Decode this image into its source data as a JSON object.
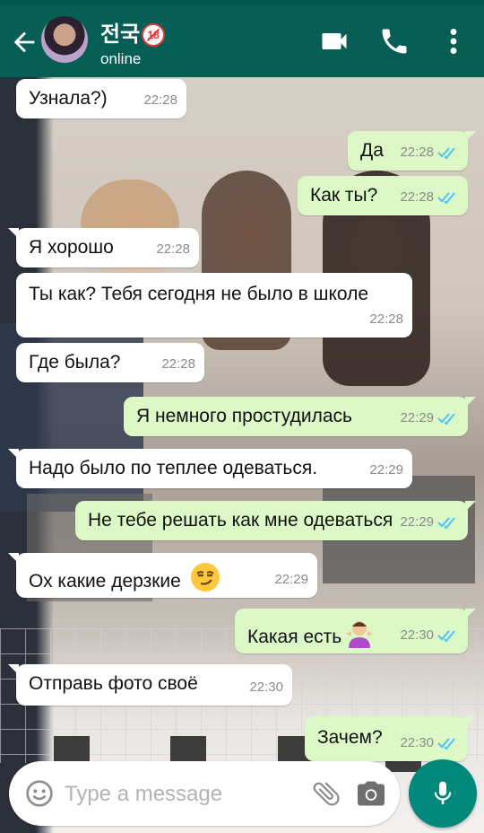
{
  "header": {
    "contact_name": "전국",
    "age_badge": "18",
    "status": "online"
  },
  "messages": [
    {
      "dir": "in",
      "text": "Узнала?)",
      "time": "22:28"
    },
    {
      "dir": "out",
      "text": "Да",
      "time": "22:28",
      "read": true
    },
    {
      "dir": "out",
      "text": "Как ты?",
      "time": "22:28",
      "read": true
    },
    {
      "dir": "in",
      "text": "Я хорошо",
      "time": "22:28"
    },
    {
      "dir": "in",
      "text": "Ты как? Тебя сегодня не было в школе",
      "time": "22:28"
    },
    {
      "dir": "in",
      "text": "Где была?",
      "time": "22:28"
    },
    {
      "dir": "out",
      "text": "Я немного простудилась",
      "time": "22:29",
      "read": true
    },
    {
      "dir": "in",
      "text": "Надо было по теплее одеваться.",
      "time": "22:29"
    },
    {
      "dir": "out",
      "text": "Не тебе решать как мне одеваться",
      "time": "22:29",
      "read": true
    },
    {
      "dir": "in",
      "text": "Ох какие дерзкие",
      "time": "22:29",
      "emoji": "smirking-face-emoji"
    },
    {
      "dir": "out",
      "text": "Какая есть",
      "time": "22:30",
      "read": true,
      "emoji": "person-shrugging-emoji"
    },
    {
      "dir": "in",
      "text": "Отправь фото своё",
      "time": "22:30"
    },
    {
      "dir": "out",
      "text": "Зачем?",
      "time": "22:30",
      "read": true
    }
  ],
  "input": {
    "placeholder": "Type a message"
  },
  "colors": {
    "header": "#075e54",
    "outgoing_bubble": "#dcf8c6",
    "incoming_bubble": "#ffffff",
    "read_ticks": "#4fc3f7",
    "mic_button": "#00897b"
  },
  "icons": [
    "back-arrow-icon",
    "video-call-icon",
    "phone-icon",
    "more-vert-icon",
    "smiley-icon",
    "paperclip-icon",
    "camera-icon",
    "microphone-icon",
    "double-check-icon"
  ]
}
